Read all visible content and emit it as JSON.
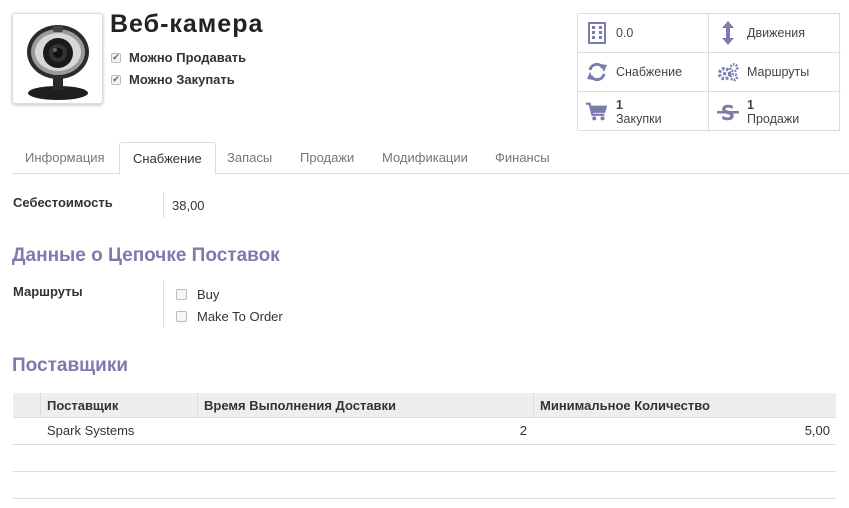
{
  "product": {
    "name": "Веб-камера",
    "image_icon": "webcam-image",
    "can_be_sold_label": "Можно Продавать",
    "can_be_sold": true,
    "can_be_purchased_label": "Можно Закупать",
    "can_be_purchased": true
  },
  "smart_buttons": {
    "stock": {
      "icon": "building-icon",
      "value": "0.0"
    },
    "moves": {
      "icon": "vertical-arrows-icon",
      "label": "Движения"
    },
    "replenish": {
      "icon": "refresh-icon",
      "label": "Снабжение"
    },
    "routes": {
      "icon": "gears-icon",
      "label": "Маршруты"
    },
    "purchases": {
      "icon": "cart-icon",
      "count": "1",
      "label": "Закупки"
    },
    "sales": {
      "icon": "strikethrough-dollar-icon",
      "count": "1",
      "label": "Продажи"
    },
    "icon_color": "#7c7bad"
  },
  "tabs": [
    {
      "label": "Информация"
    },
    {
      "label": "Снабжение",
      "active": true
    },
    {
      "label": "Запасы"
    },
    {
      "label": "Продажи"
    },
    {
      "label": "Модификации"
    },
    {
      "label": "Финансы"
    }
  ],
  "procurement": {
    "cost_label": "Себестоимость",
    "cost_value": "38,00",
    "supply_chain_title": "Данные о Цепочке Поставок",
    "routes_label": "Маршруты",
    "routes": [
      {
        "label": "Buy",
        "checked": false
      },
      {
        "label": "Make To Order",
        "checked": false
      }
    ],
    "suppliers_title": "Поставщики",
    "suppliers_table": {
      "columns": [
        "Поставщик",
        "Время Выполнения Доставки",
        "Минимальное Количество"
      ],
      "rows": [
        {
          "supplier": "Spark Systems",
          "lead_time": "2",
          "min_qty": "5,00"
        }
      ]
    }
  },
  "colors": {
    "section_title": "#7c7bad",
    "border": "#dddddd",
    "header_bg": "#eeeeee"
  }
}
